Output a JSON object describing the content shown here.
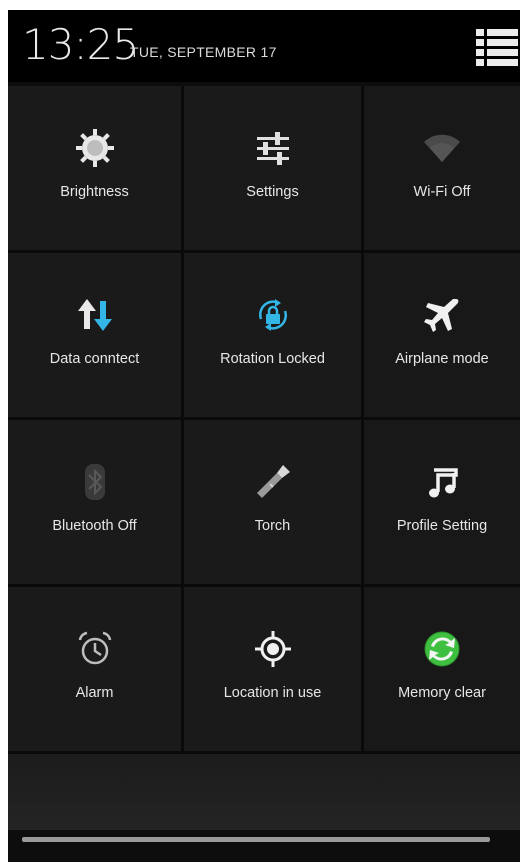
{
  "status": {
    "time": "13:25",
    "date": "TUE, SEPTEMBER 17",
    "menu_icon": "list-menu-icon"
  },
  "tiles": [
    {
      "label": "Brightness",
      "icon": "brightness-icon",
      "state": "on"
    },
    {
      "label": "Settings",
      "icon": "settings-sliders-icon",
      "state": "on"
    },
    {
      "label": "Wi-Fi Off",
      "icon": "wifi-icon",
      "state": "off"
    },
    {
      "label": "Data conntect",
      "icon": "data-arrows-icon",
      "state": "on"
    },
    {
      "label": "Rotation Locked",
      "icon": "rotation-lock-icon",
      "state": "on"
    },
    {
      "label": "Airplane mode",
      "icon": "airplane-icon",
      "state": "on"
    },
    {
      "label": "Bluetooth Off",
      "icon": "bluetooth-icon",
      "state": "off"
    },
    {
      "label": "Torch",
      "icon": "torch-icon",
      "state": "on"
    },
    {
      "label": "Profile Setting",
      "icon": "music-note-icon",
      "state": "on"
    },
    {
      "label": "Alarm",
      "icon": "alarm-clock-icon",
      "state": "on"
    },
    {
      "label": "Location in use",
      "icon": "location-target-icon",
      "state": "on"
    },
    {
      "label": "Memory clear",
      "icon": "memory-clear-icon",
      "state": "on"
    }
  ],
  "colors": {
    "accent_blue": "#33b5e5",
    "memory_green": "#3fbf3f",
    "tile_bg": "#1a1a1a",
    "text": "#e6e6e6"
  }
}
